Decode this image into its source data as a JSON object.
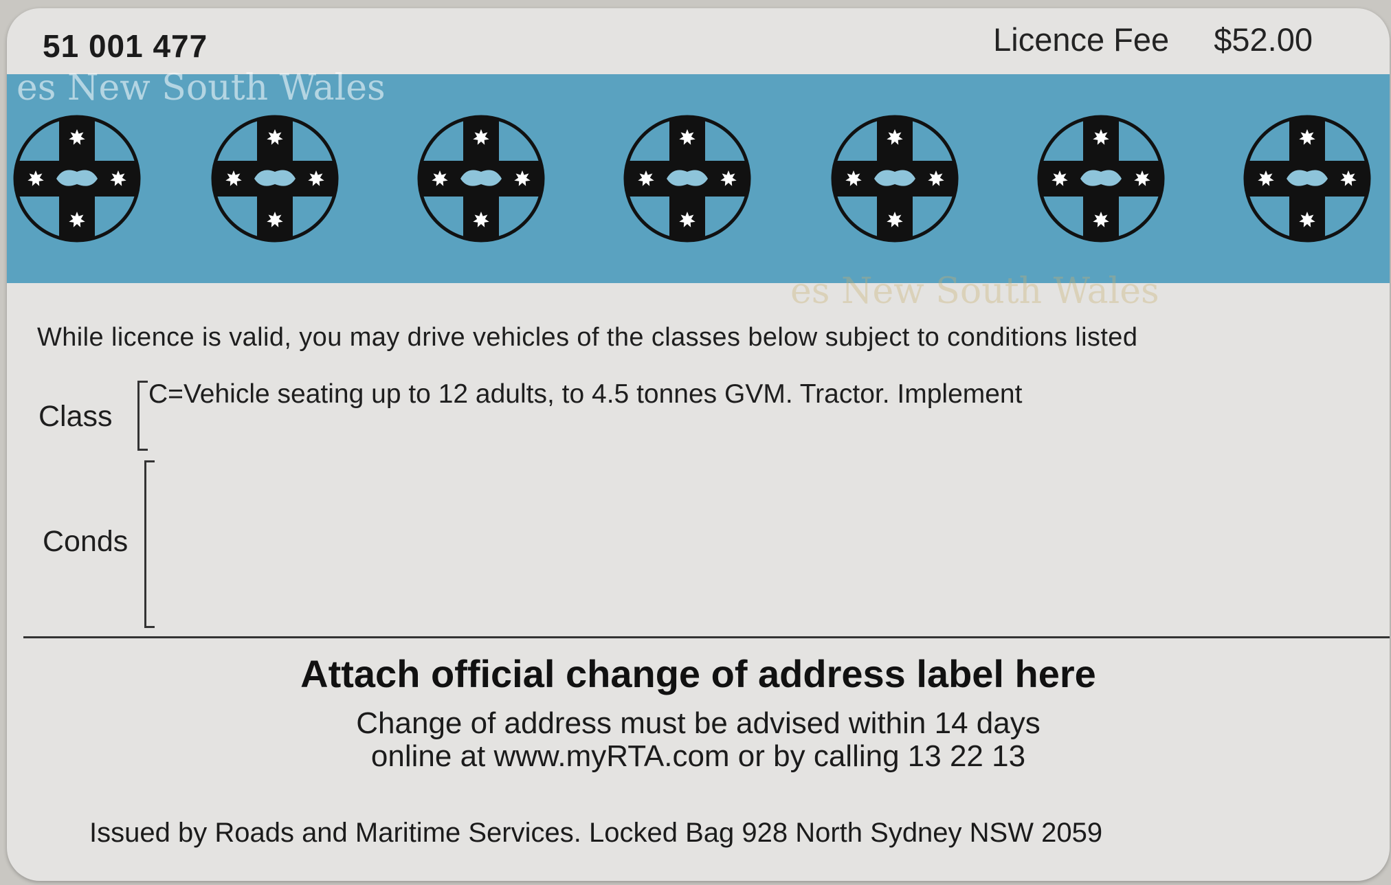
{
  "card": {
    "licence_number": "51 001 477",
    "fee_label": "Licence Fee",
    "fee_amount": "$52.00",
    "band_color": "#5aa2c0",
    "emblem_icon": "nsw-state-badge-icon",
    "emblem_count": 7,
    "hologram_text": "es New South Wales",
    "validity_text": "While licence is valid, you may drive vehicles of the classes below subject to conditions listed",
    "class_label": "Class",
    "class_value": "C=Vehicle seating up to 12 adults, to 4.5 tonnes GVM. Tractor. Implement",
    "conds_label": "Conds",
    "attach_heading": "Attach official change of address label here",
    "change_line1": "Change of address must be advised within 14 days",
    "change_line2": "online at www.myRTA.com or by calling 13 22 13",
    "issued_by": "Issued by Roads and Maritime Services. Locked Bag 928 North Sydney NSW 2059"
  }
}
